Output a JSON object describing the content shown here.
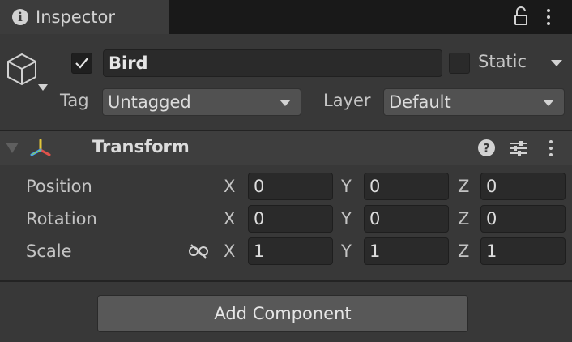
{
  "window": {
    "tab_title": "Inspector",
    "info_icon_glyph": "i",
    "lock_icon": "lock-icon",
    "menu_icon": "kebab-menu-icon"
  },
  "gameobject": {
    "icon": "cube-icon",
    "active": true,
    "name": "Bird",
    "static_label": "Static",
    "static": false,
    "tag_label": "Tag",
    "tag_value": "Untagged",
    "layer_label": "Layer",
    "layer_value": "Default"
  },
  "transform": {
    "title": "Transform",
    "icon": "transform-axes-icon",
    "help_glyph": "?",
    "help_icon": "help-icon",
    "presets_icon": "presets-sliders-icon",
    "menu_icon": "kebab-menu-icon",
    "rows": [
      {
        "label": "Position",
        "x": "0",
        "y": "0",
        "z": "0"
      },
      {
        "label": "Rotation",
        "x": "0",
        "y": "0",
        "z": "0"
      },
      {
        "label": "Scale",
        "x": "1",
        "y": "1",
        "z": "1",
        "link_icon": "unlinked-chain-icon"
      }
    ],
    "axis_x": "X",
    "axis_y": "Y",
    "axis_z": "Z"
  },
  "footer": {
    "add_component_label": "Add Component"
  },
  "colors": {
    "background": "#383838",
    "titlebar": "#191919",
    "field": "#2a2a2a",
    "text": "#d2d2d2",
    "axis_x": "#e0524a",
    "axis_y": "#8fd14f",
    "axis_z": "#3d9bff"
  }
}
